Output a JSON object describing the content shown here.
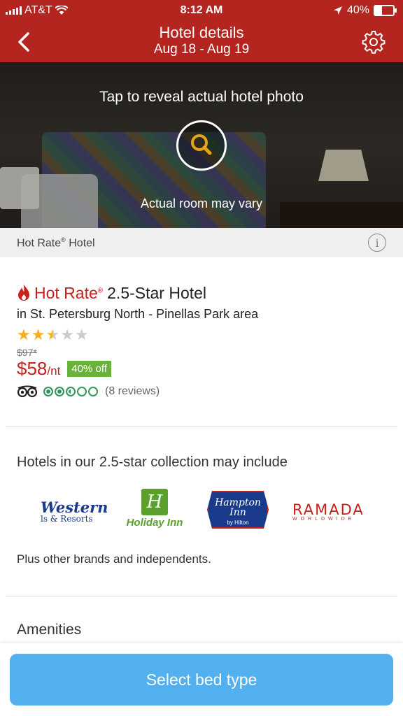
{
  "status_bar": {
    "carrier": "AT&T",
    "time": "8:12 AM",
    "battery": "40%"
  },
  "nav": {
    "title": "Hotel details",
    "dates": "Aug 18 - Aug 19"
  },
  "photo": {
    "tap_text": "Tap to reveal actual hotel photo",
    "vary_text": "Actual room may vary"
  },
  "hot_rate_bar": {
    "label": "Hot Rate",
    "reg": "®",
    "suffix": "Hotel"
  },
  "hotel": {
    "brand": "Hot Rate",
    "brand_mark": "®",
    "class": "2.5-Star Hotel",
    "area": "in St. Petersburg North - Pinellas Park area",
    "star_rating": 2.5,
    "original_price": "$97*",
    "price": "$58",
    "price_unit": "/nt",
    "discount": "40% off",
    "reviews": "(8 reviews)",
    "review_rating": 2.5
  },
  "collection": {
    "heading": "Hotels in our 2.5-star collection may include",
    "brands": {
      "bw_top": "Western",
      "bw_bottom": "ls & Resorts",
      "hi_mark": "H",
      "hi_name": "Holiday Inn",
      "hampton_top": "Hampton",
      "hampton_mid": "Inn",
      "hampton_sub": "by Hilton",
      "ramada_top": "RAMADA",
      "ramada_sub": "WORLDWIDE"
    },
    "note": "Plus other brands and independents."
  },
  "amenities": {
    "heading": "Amenities"
  },
  "cta": {
    "label": "Select bed type"
  },
  "colors": {
    "header": "#b5251f",
    "accent_red": "#c8201a",
    "discount_green": "#6ab23a",
    "cta_blue": "#52b0ef"
  }
}
